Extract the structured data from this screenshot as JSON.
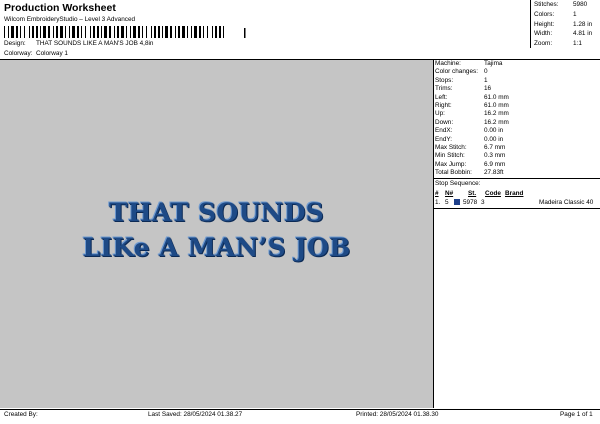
{
  "header": {
    "title": "Production Worksheet",
    "subtitle": "Wilcom EmbroideryStudio – Level 3 Advanced",
    "design_label": "Design:",
    "design_value": "THAT SOUNDS LIKE A MAN'S JOB 4,8in",
    "colorway_label": "Colorway:",
    "colorway_value": "Colorway 1"
  },
  "stats": [
    {
      "label": "Stitches:",
      "value": "5980"
    },
    {
      "label": "Colors:",
      "value": "1"
    },
    {
      "label": "Height:",
      "value": "1.28 in"
    },
    {
      "label": "Width:",
      "value": "4.81 in"
    },
    {
      "label": "Zoom:",
      "value": "1:1"
    }
  ],
  "design": {
    "line1": "THAT SOUNDS",
    "line2": "LIKe A MAN’S JOB",
    "thread_color": "#1e4a86"
  },
  "machine_info": [
    {
      "label": "Machine:",
      "value": "Tajima"
    },
    {
      "label": "Color changes:",
      "value": "0"
    },
    {
      "label": "Stops:",
      "value": "1"
    },
    {
      "label": "Trims:",
      "value": "16"
    },
    {
      "label": "Left:",
      "value": "61.0 mm"
    },
    {
      "label": "Right:",
      "value": "61.0 mm"
    },
    {
      "label": "Up:",
      "value": "16.2 mm"
    },
    {
      "label": "Down:",
      "value": "16.2 mm"
    },
    {
      "label": "EndX:",
      "value": "0.00 in"
    },
    {
      "label": "EndY:",
      "value": "0.00 in"
    },
    {
      "label": "Max Stitch:",
      "value": "6.7 mm"
    },
    {
      "label": "Min Stitch:",
      "value": "0.3 mm"
    },
    {
      "label": "Max Jump:",
      "value": "6.9 mm"
    },
    {
      "label": "Total Bobbin:",
      "value": "27.83ft"
    }
  ],
  "stop_sequence": {
    "title": "Stop Sequence:",
    "headers": {
      "num": "#",
      "n": "N#",
      "st": "St.",
      "code": "Code",
      "brand": "Brand"
    },
    "rows": [
      {
        "num": "1.",
        "n": "5",
        "swatch_color": "#1e3f8a",
        "st": "5978",
        "code": "3",
        "brand": "Madeira Classic 40"
      }
    ]
  },
  "footer": {
    "created_by": "Created By:",
    "last_saved": "Last Saved: 28/05/2024 01.38.27",
    "printed": "Printed: 28/05/2024 01.38.30",
    "page": "Page 1 of 1"
  }
}
